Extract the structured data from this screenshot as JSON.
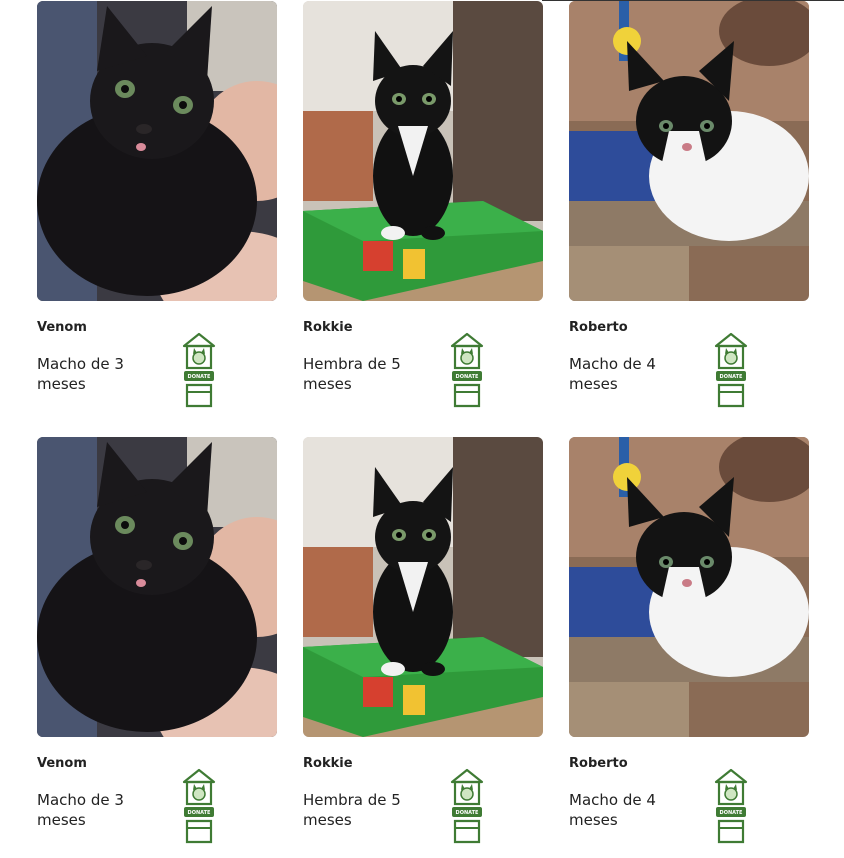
{
  "theme": {
    "accent": "#3f7b34",
    "text": "#222222"
  },
  "cards": [
    {
      "name": "Venom",
      "desc": "Macho de 3 meses",
      "photo": "black-kitten-photo",
      "donate_label": "DONATE",
      "donate_icon": "cat-house-donate-icon"
    },
    {
      "name": "Rokkie",
      "desc": "Hembra de 5 meses",
      "photo": "tuxedo-kitten-on-box-photo",
      "donate_label": "DONATE",
      "donate_icon": "cat-house-donate-icon"
    },
    {
      "name": "Roberto",
      "desc": "Macho de 4 meses",
      "photo": "tuxedo-kitten-on-shelf-photo",
      "donate_label": "DONATE",
      "donate_icon": "cat-house-donate-icon"
    },
    {
      "name": "Venom",
      "desc": "Macho de 3 meses",
      "photo": "black-kitten-photo",
      "donate_label": "DONATE",
      "donate_icon": "cat-house-donate-icon"
    },
    {
      "name": "Rokkie",
      "desc": "Hembra de 5 meses",
      "photo": "tuxedo-kitten-on-box-photo",
      "donate_label": "DONATE",
      "donate_icon": "cat-house-donate-icon"
    },
    {
      "name": "Roberto",
      "desc": "Macho de 4 meses",
      "photo": "tuxedo-kitten-on-shelf-photo",
      "donate_label": "DONATE",
      "donate_icon": "cat-house-donate-icon"
    }
  ]
}
